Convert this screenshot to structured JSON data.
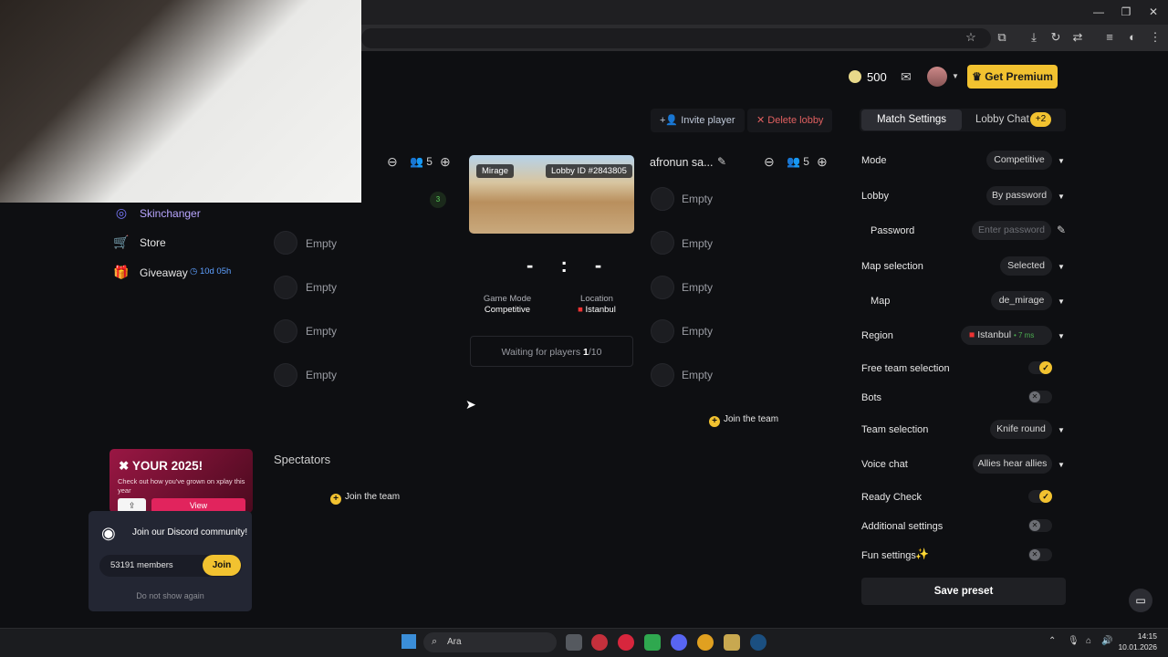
{
  "header": {
    "coins": "500",
    "premium_label": "Get Premium"
  },
  "lobby": {
    "invite_label": "Invite player",
    "delete_label": "Delete lobby",
    "left_team": {
      "count": "5",
      "slots": [
        "Empty",
        "Empty",
        "Empty",
        "Empty"
      ],
      "status_badge": "3"
    },
    "right_team": {
      "name": "afronun sa...",
      "count": "5",
      "slots": [
        "Empty",
        "Empty",
        "Empty",
        "Empty",
        "Empty"
      ]
    },
    "map_tag": "Mirage",
    "lobby_id": "Lobby ID #2843805",
    "score": "- : -",
    "game_mode_label": "Game Mode",
    "game_mode_value": "Competitive",
    "location_label": "Location",
    "location_value": "Istanbul",
    "waiting_prefix": "Waiting for players ",
    "waiting_count": "1",
    "waiting_total": "/10",
    "join_team": "Join the team",
    "spectators_title": "Spectators",
    "spectators_join": "Join the team"
  },
  "sidebar": {
    "items": [
      {
        "label": "Skinchanger",
        "icon": "skinchanger-icon"
      },
      {
        "label": "Store",
        "icon": "cart-icon"
      },
      {
        "label": "Giveaway",
        "icon": "gift-icon"
      }
    ],
    "giveaway_timer": "10d 05h"
  },
  "promo": {
    "title": "YOUR 2025!",
    "text": "Check out how you've grown on xplay this year",
    "view_label": "View"
  },
  "discord": {
    "title": "Join our Discord community!",
    "members": "53191 members",
    "join_label": "Join",
    "dismiss_label": "Do not show again"
  },
  "tabs": {
    "match_settings": "Match Settings",
    "lobby_chat": "Lobby Chat",
    "lobby_chat_badge": "+2"
  },
  "settings": {
    "mode_label": "Mode",
    "mode_value": "Competitive",
    "lobby_label": "Lobby",
    "lobby_value": "By password",
    "password_label": "Password",
    "password_placeholder": "Enter password",
    "map_selection_label": "Map selection",
    "map_selection_value": "Selected",
    "map_label": "Map",
    "map_value": "de_mirage",
    "region_label": "Region",
    "region_value": "Istanbul",
    "region_ping": "• 7 ms",
    "free_team_label": "Free team selection",
    "free_team_on": true,
    "bots_label": "Bots",
    "bots_on": false,
    "team_selection_label": "Team selection",
    "team_selection_value": "Knife round",
    "voice_chat_label": "Voice chat",
    "voice_chat_value": "Allies hear allies",
    "ready_check_label": "Ready Check",
    "ready_check_on": true,
    "additional_label": "Additional settings",
    "additional_on": false,
    "fun_label": "Fun settings",
    "fun_on": false,
    "save_label": "Save preset"
  },
  "taskbar": {
    "search_label": "Ara",
    "time": "14:15",
    "date": "10.01.2026"
  }
}
